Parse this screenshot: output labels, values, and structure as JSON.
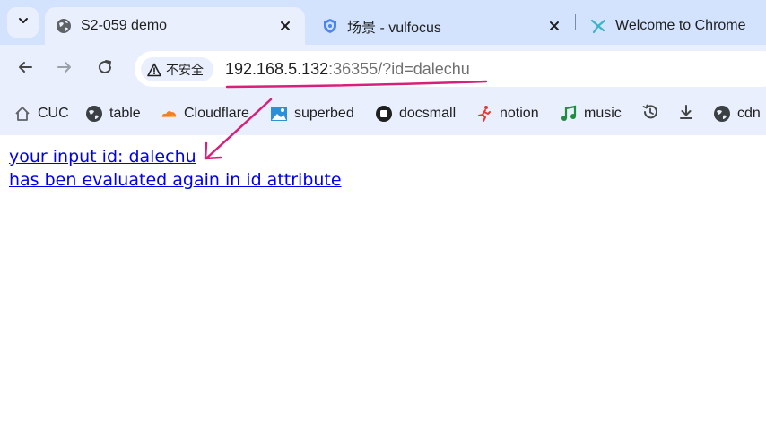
{
  "tabs": [
    {
      "title": "S2-059 demo",
      "favicon": "globe-icon",
      "active": true
    },
    {
      "title": "场景 - vulfocus",
      "favicon": "shield-icon",
      "active": false
    },
    {
      "title": "Welcome to Chrome",
      "favicon": "chrome-star-icon",
      "active": false
    }
  ],
  "toolbar": {
    "security_label": "不安全",
    "url_host": "192.168.5.132",
    "url_rest": ":36355/?id=dalechu"
  },
  "bookmarks": [
    {
      "label": "CUC",
      "icon": "house-icon"
    },
    {
      "label": "table",
      "icon": "globe-icon"
    },
    {
      "label": "Cloudflare",
      "icon": "cloud-icon"
    },
    {
      "label": "superbed",
      "icon": "image-icon"
    },
    {
      "label": "docsmall",
      "icon": "circle-square-icon"
    },
    {
      "label": "notion",
      "icon": "runner-icon"
    },
    {
      "label": "music",
      "icon": "music-note-icon"
    },
    {
      "label": "",
      "icon": "history-icon"
    },
    {
      "label": "",
      "icon": "download-icon"
    },
    {
      "label": "cdn",
      "icon": "globe-icon"
    }
  ],
  "content": {
    "line1": "your input id: dalechu",
    "line2": "has ben evaluated again in id attribute"
  },
  "colors": {
    "tabstrip": "#d3e3fd",
    "toolbar": "#e9effc",
    "link": "#0000ee",
    "annotation": "#d6207b"
  }
}
